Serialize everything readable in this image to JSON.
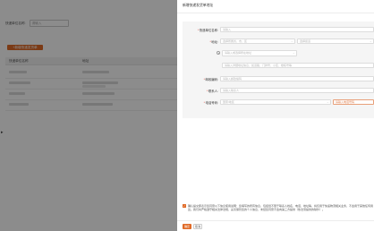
{
  "background": {
    "filter_label": "快递单位名称:",
    "filter_placeholder": "请输入",
    "add_button_label": "+新增快递发货单",
    "table_headers": [
      "快递单位名称",
      "地址"
    ]
  },
  "drawer": {
    "title": "新增快递发货单地址",
    "fields": {
      "company_name": {
        "label": "快递单位名称:",
        "placeholder": "请输入"
      },
      "address": {
        "label": "地址:",
        "province_placeholder": "选择所属省、市、区",
        "street_placeholder": "选择街道",
        "street_select_placeholder": "请输入或选择所在地址",
        "detail_placeholder": "请输入详细地址信息，如道路、门牌号、小区、楼栋号等"
      },
      "postcode": {
        "label": "邮政编码:",
        "placeholder": "请输入邮政编码"
      },
      "contact": {
        "label": "联系人:",
        "placeholder": "请输入联系人"
      },
      "phone": {
        "label": "电话号码:",
        "area_placeholder": "国家/地区",
        "number_placeholder": "请输入电话号码"
      }
    },
    "agreement_text": "确认提交即表示您同意以下信息使用说明：您填写的所有信息，包括但不限于联系人姓名、电话、地址等，将仅用于快递物流相关业务，不会用于其他任何用途。我们将严格遵守相关法律法规，妥善保管您的个人信息，未经您同意不会向第三方提供（依法须提供的除外）。",
    "ok_label": "确定",
    "cancel_label": "取消"
  },
  "colors": {
    "accent": "#e06a27",
    "overlay": "rgba(0,0,0,0.45)",
    "error_border": "#e8a07a"
  }
}
